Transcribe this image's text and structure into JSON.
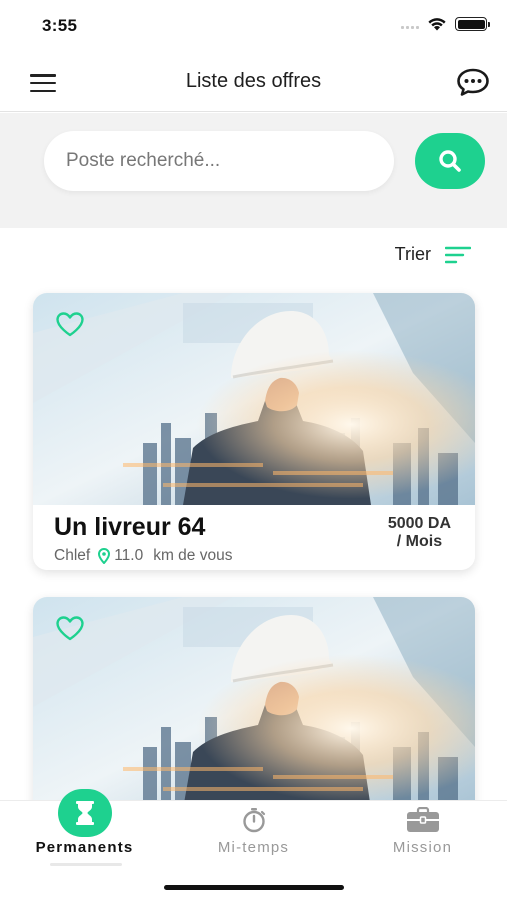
{
  "status_bar": {
    "time": "3:55"
  },
  "header": {
    "title": "Liste des offres",
    "menu_icon": "hamburger-menu-icon",
    "chat_icon": "chat-bubble-icon"
  },
  "search": {
    "placeholder": "Poste recherché...",
    "value": "",
    "button_icon": "search-icon"
  },
  "sort": {
    "label": "Trier",
    "icon": "sort-lines-icon"
  },
  "offers": [
    {
      "title": "Un livreur 64",
      "city": "Chlef",
      "distance": "11.0",
      "distance_suffix": "km de vous",
      "salary_amount": "5000 DA",
      "salary_period": "/ Mois",
      "favorite": false
    }
  ],
  "bottom_nav": {
    "items": [
      {
        "label": "Permanents",
        "icon": "hourglass-icon",
        "active": true
      },
      {
        "label": "Mi-temps",
        "icon": "stopwatch-icon",
        "active": false
      },
      {
        "label": "Mission",
        "icon": "briefcase-icon",
        "active": false
      }
    ]
  },
  "colors": {
    "accent": "#1ed18f",
    "text": "#1c1c1c",
    "muted": "#999999",
    "search_bg": "#f2f2f2"
  }
}
